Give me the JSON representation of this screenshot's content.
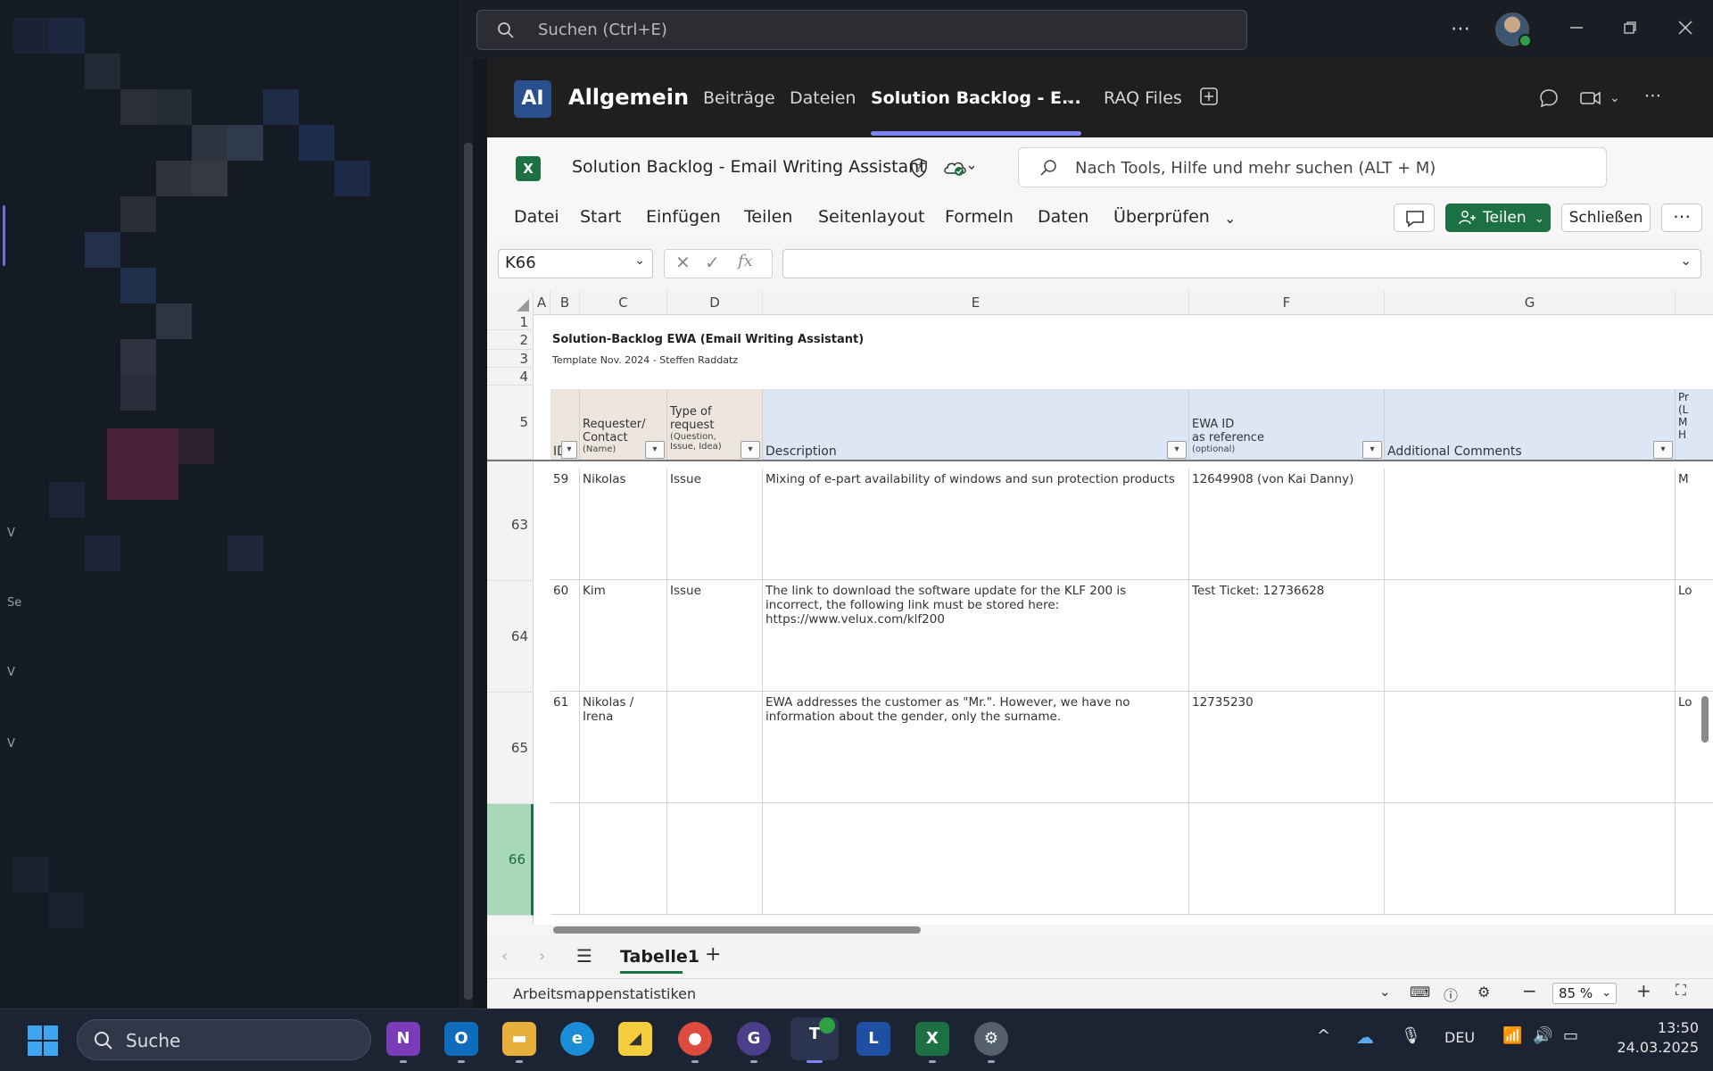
{
  "titlebar": {
    "search_placeholder": "Suchen (Ctrl+E)"
  },
  "channel": {
    "logo_text": "AI",
    "name": "Allgemein",
    "tabs": [
      {
        "label": "Beiträge"
      },
      {
        "label": "Dateien"
      },
      {
        "label": "Solution Backlog - E..."
      },
      {
        "label": "RAQ Files"
      }
    ]
  },
  "excel": {
    "doc_title": "Solution Backlog - Email Writing Assistant",
    "search_placeholder": "Nach Tools, Hilfe und mehr suchen (ALT + M)",
    "ribbon_tabs": [
      "Datei",
      "Start",
      "Einfügen",
      "Teilen",
      "Seitenlayout",
      "Formeln",
      "Daten",
      "Überprüfen"
    ],
    "share_label": "Teilen",
    "close_label": "Schließen",
    "name_box": "K66",
    "fx_label": "fx"
  },
  "grid": {
    "columns": [
      "A",
      "B",
      "C",
      "D",
      "E",
      "F",
      "G"
    ],
    "rows_top": [
      "1",
      "2",
      "3",
      "4",
      "5"
    ],
    "rows_body": [
      "63",
      "64",
      "65",
      "66"
    ],
    "sheet_title": "Solution-Backlog EWA (Email Writing Assistant)",
    "sheet_subtitle": "Template Nov. 2024 - Steffen Raddatz",
    "headers": {
      "id": "ID",
      "requester_line1": "Requester/",
      "requester_line2": "Contact",
      "requester_small": "(Name)",
      "type_line1": "Type of",
      "type_line2": "request",
      "type_small": "(Question, Issue, Idea)",
      "description": "Description",
      "ewa_line1": "EWA ID",
      "ewa_line2": "as reference",
      "ewa_small": "(optional)",
      "comments": "Additional Comments",
      "next_col_partial": "Pr (L M H"
    },
    "body": [
      {
        "id": "59",
        "requester": "Nikolas",
        "type": "Issue",
        "description": "Mixing of e-part availability of windows and sun protection products",
        "ewa": "12649908 (von Kai Danny)",
        "comments": "",
        "next": "M"
      },
      {
        "id": "60",
        "requester": "Kim",
        "type": "Issue",
        "description": "The link to download the software update for the KLF 200 is incorrect, the following link must be stored here: https://www.velux.com/klf200",
        "ewa": "Test Ticket: 12736628",
        "comments": "",
        "next": "Lo"
      },
      {
        "id": "61",
        "requester": "Nikolas / Irena",
        "type": "",
        "description": "EWA addresses the customer as \"Mr.\". However, we have no information about the gender, only the surname.",
        "ewa": "12735230",
        "comments": "",
        "next": "Lo"
      },
      {
        "id": "",
        "requester": "",
        "type": "",
        "description": "",
        "ewa": "",
        "comments": "",
        "next": ""
      }
    ]
  },
  "sheet_tabs": {
    "active": "Tabelle1"
  },
  "status": {
    "text": "Arbeitsmappenstatistiken",
    "zoom": "85 %"
  },
  "taskbar": {
    "search_label": "Suche",
    "language": "DEU",
    "time": "13:50",
    "date": "24.03.2025"
  }
}
